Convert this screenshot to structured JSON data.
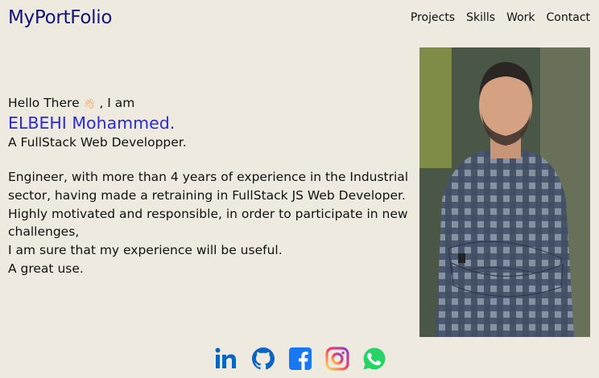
{
  "header": {
    "logo": "MyPortFolio",
    "nav": [
      "Projects",
      "Skills",
      "Work",
      "Contact"
    ]
  },
  "intro": {
    "greeting_before": "Hello There",
    "greeting_emoji": "👋🏻",
    "greeting_after": ", I am",
    "name": "ELBEHI Mohammed.",
    "role": "A FullStack Web Developper.",
    "bio_lines": [
      "Engineer, with more than 4 years of experience in the Industrial sector, having made a retraining in FullStack JS Web Developer.",
      "Highly motivated and responsible, in order to participate in new challenges,",
      "I am sure that my experience will be useful.",
      "A great use."
    ]
  },
  "socials": [
    "linkedin-icon",
    "github-icon",
    "facebook-icon",
    "instagram-icon",
    "whatsapp-icon"
  ],
  "colors": {
    "background": "#eeeae0",
    "logo": "#13137a",
    "name": "#2a2ad9",
    "linkedin": "#0a66c2",
    "facebook": "#1877f2",
    "whatsapp": "#25d366"
  }
}
